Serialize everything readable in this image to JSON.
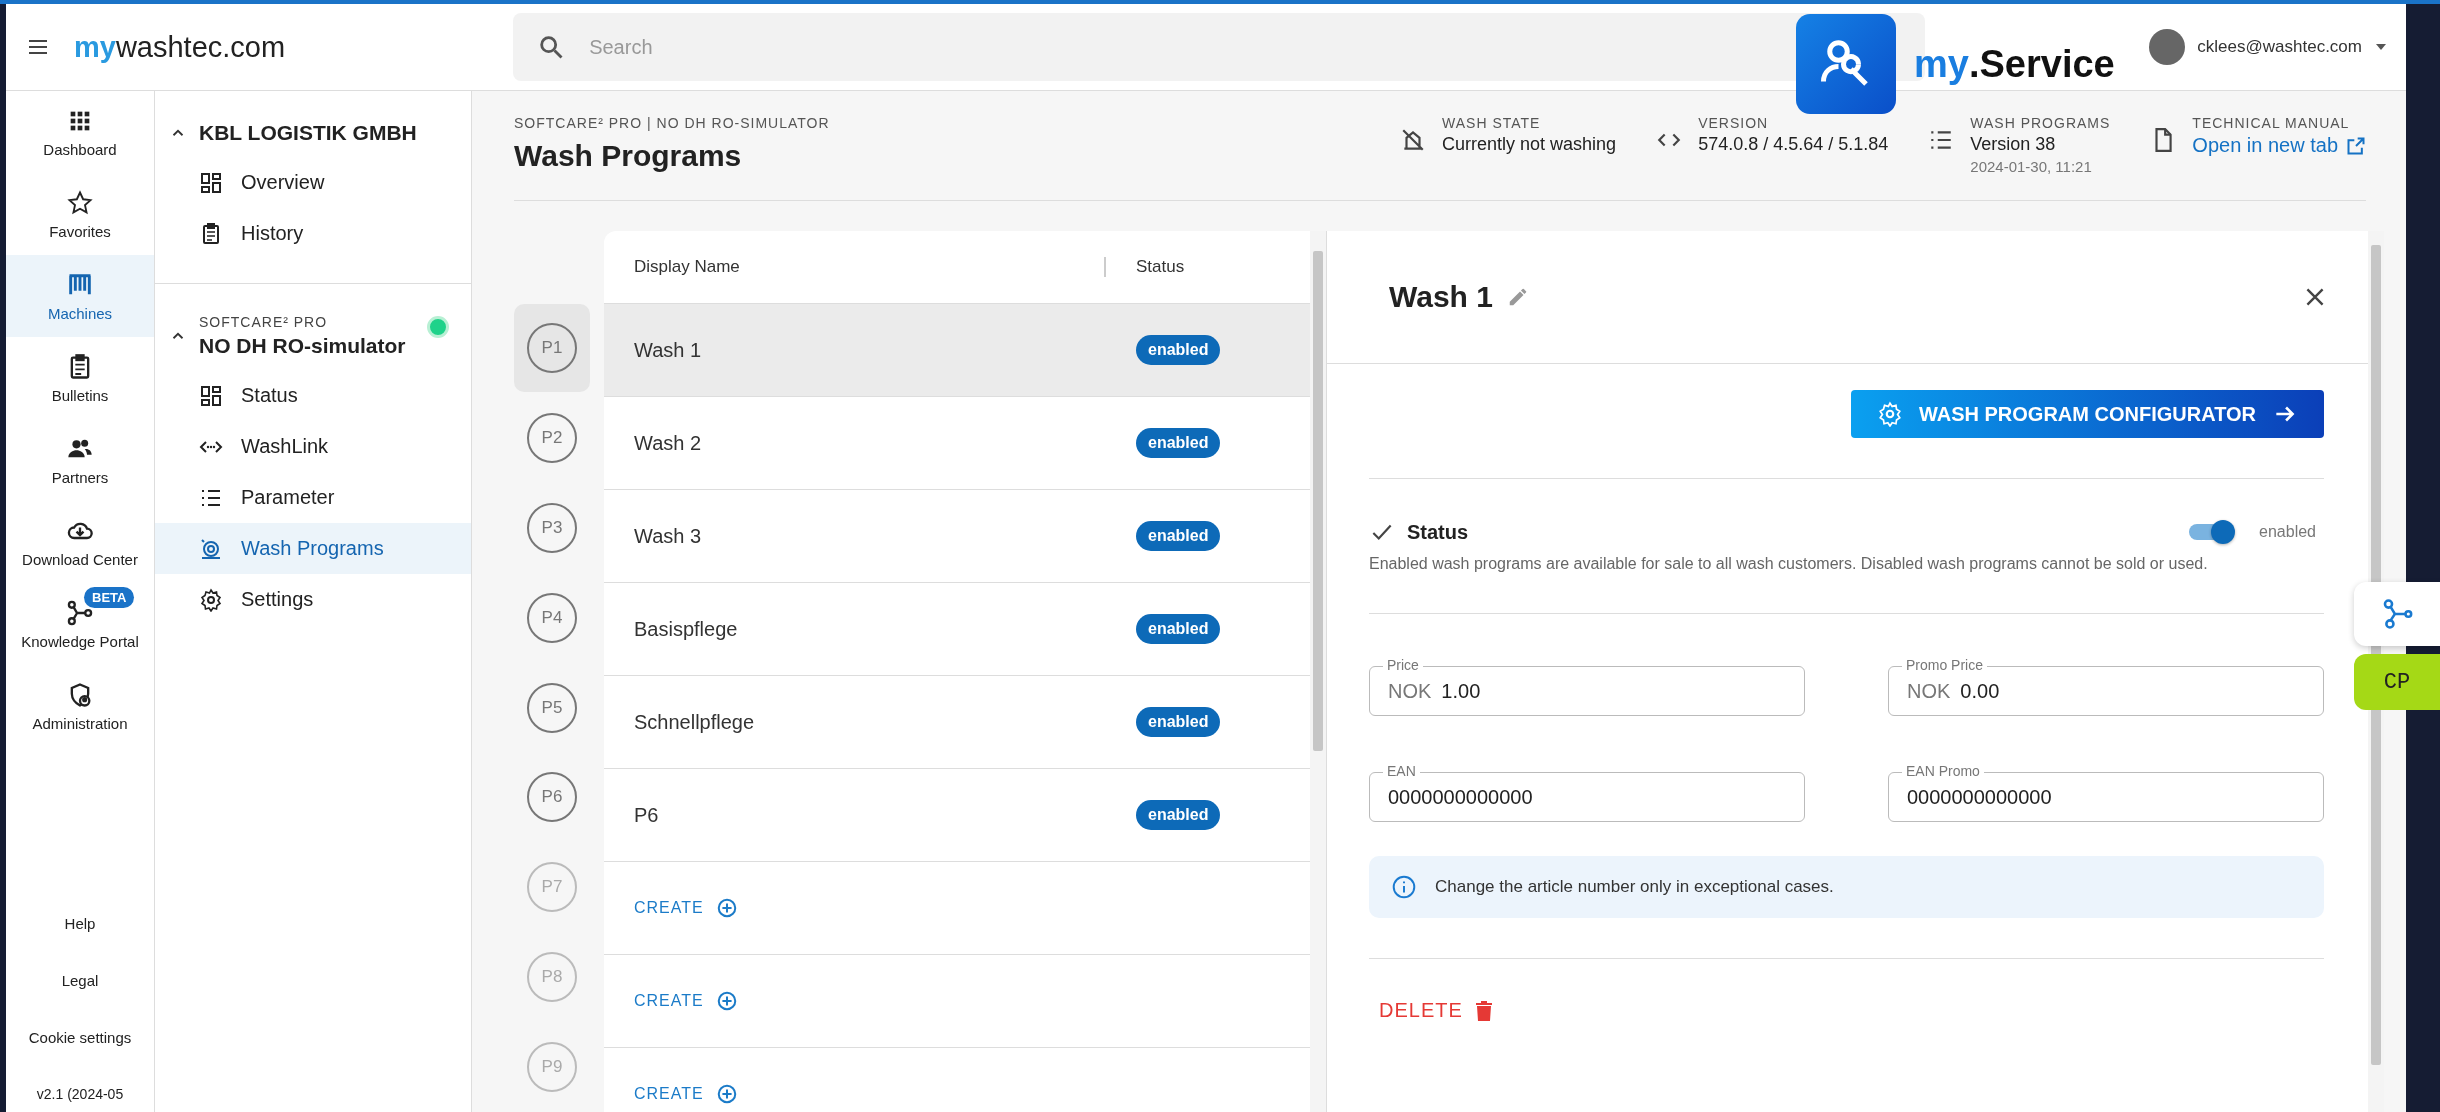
{
  "top_bar": {
    "logo_prefix": "my",
    "logo_name": "washtec.com",
    "search": {
      "placeholder": "Search"
    },
    "user": "cklees@washtec.com"
  },
  "service_badge": {
    "prefix": "my",
    "name": ".Service"
  },
  "rail": {
    "items": [
      {
        "label": "Dashboard",
        "selected": false
      },
      {
        "label": "Favorites",
        "selected": false
      },
      {
        "label": "Machines",
        "selected": true
      },
      {
        "label": "Bulletins",
        "selected": false
      },
      {
        "label": "Partners",
        "selected": false
      },
      {
        "label": "Download Center",
        "selected": false
      },
      {
        "label": "Knowledge Portal",
        "selected": false,
        "badge": "BETA"
      },
      {
        "label": "Administration",
        "selected": false
      }
    ],
    "footer": [
      "Help",
      "Legal",
      "Cookie settings"
    ],
    "version": "v2.1 (2024-05"
  },
  "nav": {
    "groups": [
      {
        "title": "KBL LOGISTIK GMBH",
        "expanded": true,
        "items": [
          {
            "label": "Overview",
            "selected": false
          },
          {
            "label": "History",
            "selected": false
          }
        ]
      },
      {
        "subtitle": "SOFTCARE² PRO",
        "title": "NO DH RO-simulator",
        "expanded": true,
        "online": true,
        "items": [
          {
            "label": "Status",
            "selected": false
          },
          {
            "label": "WashLink",
            "selected": false
          },
          {
            "label": "Parameter",
            "selected": false
          },
          {
            "label": "Wash Programs",
            "selected": true
          },
          {
            "label": "Settings",
            "selected": false
          }
        ]
      }
    ]
  },
  "header": {
    "breadcrumb": "SOFTCARE² PRO | NO DH RO-SIMULATOR",
    "title": "Wash Programs",
    "facts": [
      {
        "kind": "washstate",
        "label": "WASH STATE",
        "value": "Currently not washing"
      },
      {
        "kind": "version",
        "label": "VERSION",
        "value": "574.0.8 / 4.5.64 / 5.1.84"
      },
      {
        "kind": "programs",
        "label": "WASH PROGRAMS",
        "value": "Version 38",
        "sub": "2024-01-30, 11:21"
      },
      {
        "kind": "manual",
        "label": "TECHNICAL MANUAL",
        "link": "Open in new tab"
      }
    ]
  },
  "table": {
    "columns": [
      "Display Name",
      "Status"
    ],
    "rows": [
      {
        "slot": "P1",
        "kind": "program",
        "name": "Wash 1",
        "status": "enabled",
        "selected": true
      },
      {
        "slot": "P2",
        "kind": "program",
        "name": "Wash 2",
        "status": "enabled",
        "selected": false
      },
      {
        "slot": "P3",
        "kind": "program",
        "name": "Wash 3",
        "status": "enabled",
        "selected": false
      },
      {
        "slot": "P4",
        "kind": "program",
        "name": "Basispflege",
        "status": "enabled",
        "selected": false
      },
      {
        "slot": "P5",
        "kind": "program",
        "name": "Schnellpflege",
        "status": "enabled",
        "selected": false
      },
      {
        "slot": "P6",
        "kind": "program",
        "name": "P6",
        "status": "enabled",
        "selected": false
      },
      {
        "slot": "P7",
        "kind": "empty",
        "action": "CREATE",
        "selected": false
      },
      {
        "slot": "P8",
        "kind": "empty",
        "action": "CREATE",
        "selected": false
      },
      {
        "slot": "P9",
        "kind": "empty",
        "action": "CREATE",
        "selected": false
      }
    ]
  },
  "detail": {
    "title": "Wash 1",
    "configurator": "WASH PROGRAM CONFIGURATOR",
    "status": {
      "label": "Status",
      "on": true,
      "state_text": "enabled",
      "note": "Enabled wash programs are available for sale to all wash customers. Disabled wash programs cannot be sold or used."
    },
    "fields": [
      {
        "label": "Price",
        "prefix": "NOK",
        "value": "1.00"
      },
      {
        "label": "Promo Price",
        "prefix": "NOK",
        "value": "0.00"
      },
      {
        "label": "EAN",
        "value": "0000000000000"
      },
      {
        "label": "EAN Promo",
        "value": "0000000000000"
      }
    ],
    "info": "Change the article number only in exceptional cases.",
    "delete": "DELETE"
  },
  "side_buttons": {
    "cp": "CP"
  }
}
